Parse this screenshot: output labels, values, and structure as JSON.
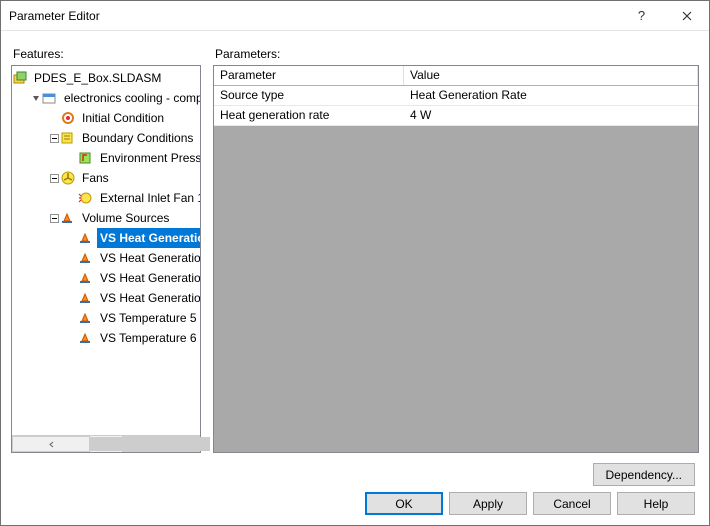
{
  "title": "Parameter Editor",
  "labels": {
    "features": "Features:",
    "parameters": "Parameters:"
  },
  "tree": {
    "root": "PDES_E_Box.SLDASM",
    "proj": "electronics cooling - completed",
    "init": "Initial Condition",
    "bc": "Boundary Conditions",
    "bc1": "Environment Pressure",
    "fans": "Fans",
    "fan1": "External Inlet Fan 1",
    "vs": "Volume Sources",
    "vs1": "VS Heat Generation",
    "vs2": "VS Heat Generation R",
    "vs3": "VS Heat Generation R",
    "vs4": "VS Heat Generation R",
    "vs5": "VS Temperature 5",
    "vs6": "VS Temperature 6"
  },
  "grid": {
    "h1": "Parameter",
    "h2": "Value",
    "rows": [
      {
        "p": "Source type",
        "v": "Heat Generation Rate"
      },
      {
        "p": "Heat generation rate",
        "v": "4 W"
      }
    ]
  },
  "buttons": {
    "dependency": "Dependency...",
    "ok": "OK",
    "apply": "Apply",
    "cancel": "Cancel",
    "help": "Help"
  }
}
